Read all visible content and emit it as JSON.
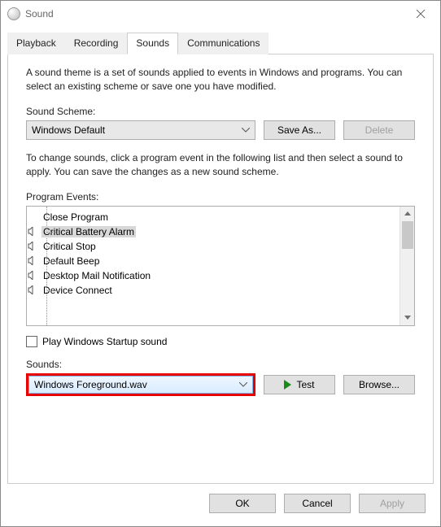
{
  "window": {
    "title": "Sound"
  },
  "tabs": [
    "Playback",
    "Recording",
    "Sounds",
    "Communications"
  ],
  "activeTab": 2,
  "descriptions": {
    "theme": "A sound theme is a set of sounds applied to events in Windows and programs.  You can select an existing scheme or save one you have modified.",
    "change": "To change sounds, click a program event in the following list and then select a sound to apply.  You can save the changes as a new sound scheme."
  },
  "labels": {
    "scheme": "Sound Scheme:",
    "events": "Program Events:",
    "startup": "Play Windows Startup sound",
    "sounds": "Sounds:"
  },
  "scheme": {
    "value": "Windows Default",
    "saveAs": "Save As...",
    "delete": "Delete"
  },
  "events": [
    {
      "label": "Close Program",
      "hasSound": false,
      "selected": false
    },
    {
      "label": "Critical Battery Alarm",
      "hasSound": true,
      "selected": true
    },
    {
      "label": "Critical Stop",
      "hasSound": true,
      "selected": false
    },
    {
      "label": "Default Beep",
      "hasSound": true,
      "selected": false
    },
    {
      "label": "Desktop Mail Notification",
      "hasSound": true,
      "selected": false
    },
    {
      "label": "Device Connect",
      "hasSound": true,
      "selected": false
    }
  ],
  "soundFile": {
    "value": "Windows Foreground.wav",
    "test": "Test",
    "browse": "Browse..."
  },
  "footer": {
    "ok": "OK",
    "cancel": "Cancel",
    "apply": "Apply"
  }
}
